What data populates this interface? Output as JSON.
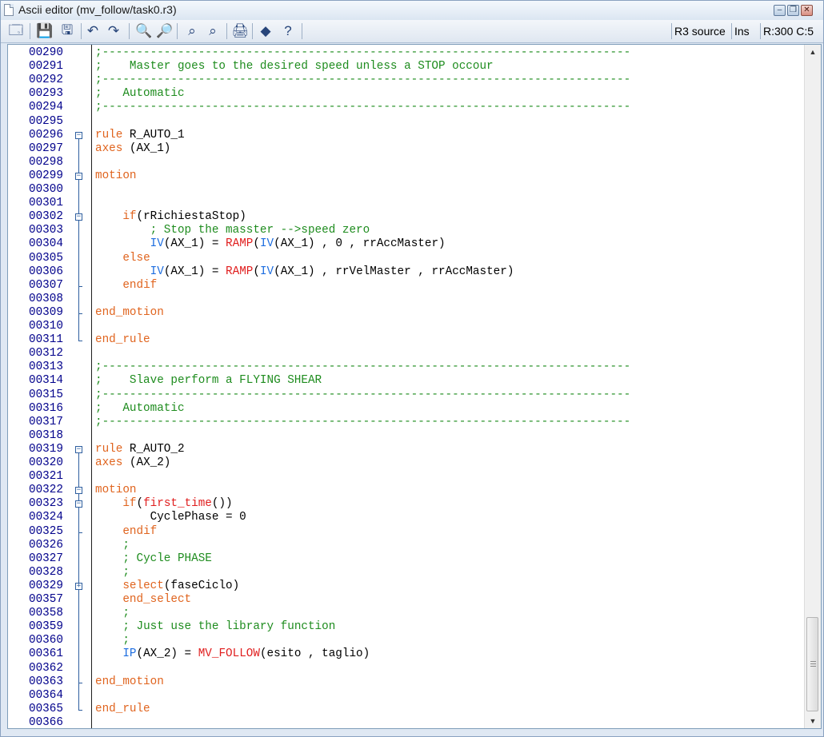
{
  "window": {
    "title": "Ascii editor (mv_follow/task0.r3)",
    "controls": [
      "minimize",
      "restore",
      "close"
    ]
  },
  "toolbar": {
    "buttons": [
      {
        "name": "properties-button",
        "icon": "properties-icon",
        "glyph": "🗔"
      },
      {
        "name": "save-button",
        "icon": "save-icon",
        "glyph": "💾"
      },
      {
        "name": "save-all-button",
        "icon": "save-all-icon",
        "glyph": "🖫"
      },
      {
        "name": "undo-button",
        "icon": "undo-icon",
        "glyph": "↶"
      },
      {
        "name": "redo-button",
        "icon": "redo-icon",
        "glyph": "↷"
      },
      {
        "name": "find-button",
        "icon": "find-icon",
        "glyph": "🔍"
      },
      {
        "name": "find-next-button",
        "icon": "find-next-icon",
        "glyph": "🔎"
      },
      {
        "name": "replace-button",
        "icon": "replace-icon",
        "glyph": "⌕"
      },
      {
        "name": "replace-next-button",
        "icon": "replace-next-icon",
        "glyph": "⌕"
      },
      {
        "name": "print-button",
        "icon": "printer-icon",
        "glyph": "🖨"
      },
      {
        "name": "compile-button",
        "icon": "compile-icon",
        "glyph": "◆"
      },
      {
        "name": "help-button",
        "icon": "help-icon",
        "glyph": "?"
      }
    ],
    "status": {
      "source": "R3 source",
      "mode": "Ins",
      "position": "R:300 C:5"
    }
  },
  "colors": {
    "comment": "#1e8c1e",
    "keyword": "#e0641e",
    "function": "#e01e1e",
    "variable": "#1e6ee0",
    "line_number": "#00008b",
    "text": "#000000"
  },
  "lines": [
    {
      "n": "00290",
      "tokens": [
        [
          "cm",
          ";-----------------------------------------------------------------------------"
        ]
      ]
    },
    {
      "n": "00291",
      "tokens": [
        [
          "cm",
          ";    Master goes to the desired speed unless a STOP occour"
        ]
      ]
    },
    {
      "n": "00292",
      "tokens": [
        [
          "cm",
          ";-----------------------------------------------------------------------------"
        ]
      ]
    },
    {
      "n": "00293",
      "tokens": [
        [
          "cm",
          ";   Automatic"
        ]
      ]
    },
    {
      "n": "00294",
      "tokens": [
        [
          "cm",
          ";-----------------------------------------------------------------------------"
        ]
      ]
    },
    {
      "n": "00295",
      "tokens": []
    },
    {
      "n": "00296",
      "tokens": [
        [
          "kw",
          "rule"
        ],
        [
          "tx",
          " R_AUTO_1"
        ]
      ],
      "fold": "box"
    },
    {
      "n": "00297",
      "tokens": [
        [
          "kw",
          "axes"
        ],
        [
          "tx",
          " (AX_1)"
        ]
      ]
    },
    {
      "n": "00298",
      "tokens": []
    },
    {
      "n": "00299",
      "tokens": [
        [
          "kw",
          "motion"
        ]
      ],
      "fold": "box"
    },
    {
      "n": "00300",
      "tokens": []
    },
    {
      "n": "00301",
      "tokens": []
    },
    {
      "n": "00302",
      "tokens": [
        [
          "tx",
          "    "
        ],
        [
          "kw",
          "if"
        ],
        [
          "tx",
          "(rRichiestaStop)"
        ]
      ],
      "fold": "box"
    },
    {
      "n": "00303",
      "tokens": [
        [
          "tx",
          "        "
        ],
        [
          "cm",
          "; Stop the masster -->speed zero"
        ]
      ]
    },
    {
      "n": "00304",
      "tokens": [
        [
          "tx",
          "        "
        ],
        [
          "iv",
          "IV"
        ],
        [
          "tx",
          "(AX_1) = "
        ],
        [
          "fn",
          "RAMP"
        ],
        [
          "tx",
          "("
        ],
        [
          "iv",
          "IV"
        ],
        [
          "tx",
          "(AX_1) , 0 , rrAccMaster)"
        ]
      ]
    },
    {
      "n": "00305",
      "tokens": [
        [
          "tx",
          "    "
        ],
        [
          "kw",
          "else"
        ]
      ]
    },
    {
      "n": "00306",
      "tokens": [
        [
          "tx",
          "        "
        ],
        [
          "iv",
          "IV"
        ],
        [
          "tx",
          "(AX_1) = "
        ],
        [
          "fn",
          "RAMP"
        ],
        [
          "tx",
          "("
        ],
        [
          "iv",
          "IV"
        ],
        [
          "tx",
          "(AX_1) , rrVelMaster , rrAccMaster)"
        ]
      ]
    },
    {
      "n": "00307",
      "tokens": [
        [
          "tx",
          "    "
        ],
        [
          "kw",
          "endif"
        ]
      ]
    },
    {
      "n": "00308",
      "tokens": []
    },
    {
      "n": "00309",
      "tokens": [
        [
          "kw",
          "end_motion"
        ]
      ]
    },
    {
      "n": "00310",
      "tokens": []
    },
    {
      "n": "00311",
      "tokens": [
        [
          "kw",
          "end_rule"
        ]
      ]
    },
    {
      "n": "00312",
      "tokens": []
    },
    {
      "n": "00313",
      "tokens": [
        [
          "cm",
          ";-----------------------------------------------------------------------------"
        ]
      ]
    },
    {
      "n": "00314",
      "tokens": [
        [
          "cm",
          ";    Slave perform a FLYING SHEAR"
        ]
      ]
    },
    {
      "n": "00315",
      "tokens": [
        [
          "cm",
          ";-----------------------------------------------------------------------------"
        ]
      ]
    },
    {
      "n": "00316",
      "tokens": [
        [
          "cm",
          ";   Automatic"
        ]
      ]
    },
    {
      "n": "00317",
      "tokens": [
        [
          "cm",
          ";-----------------------------------------------------------------------------"
        ]
      ]
    },
    {
      "n": "00318",
      "tokens": []
    },
    {
      "n": "00319",
      "tokens": [
        [
          "kw",
          "rule"
        ],
        [
          "tx",
          " R_AUTO_2"
        ]
      ],
      "fold": "box"
    },
    {
      "n": "00320",
      "tokens": [
        [
          "kw",
          "axes"
        ],
        [
          "tx",
          " (AX_2)"
        ]
      ]
    },
    {
      "n": "00321",
      "tokens": []
    },
    {
      "n": "00322",
      "tokens": [
        [
          "kw",
          "motion"
        ]
      ],
      "fold": "box"
    },
    {
      "n": "00323",
      "tokens": [
        [
          "tx",
          "    "
        ],
        [
          "kw",
          "if"
        ],
        [
          "tx",
          "("
        ],
        [
          "fn",
          "first_time"
        ],
        [
          "tx",
          "())"
        ]
      ],
      "fold": "box"
    },
    {
      "n": "00324",
      "tokens": [
        [
          "tx",
          "        CyclePhase = 0"
        ]
      ]
    },
    {
      "n": "00325",
      "tokens": [
        [
          "tx",
          "    "
        ],
        [
          "kw",
          "endif"
        ]
      ]
    },
    {
      "n": "00326",
      "tokens": [
        [
          "tx",
          "    "
        ],
        [
          "cm",
          ";"
        ]
      ]
    },
    {
      "n": "00327",
      "tokens": [
        [
          "tx",
          "    "
        ],
        [
          "cm",
          "; Cycle PHASE"
        ]
      ]
    },
    {
      "n": "00328",
      "tokens": [
        [
          "tx",
          "    "
        ],
        [
          "cm",
          ";"
        ]
      ]
    },
    {
      "n": "00329",
      "tokens": [
        [
          "tx",
          "    "
        ],
        [
          "kw",
          "select"
        ],
        [
          "tx",
          "(faseCiclo)"
        ]
      ],
      "fold": "plus"
    },
    {
      "n": "00357",
      "tokens": [
        [
          "tx",
          "    "
        ],
        [
          "kw",
          "end_select"
        ]
      ]
    },
    {
      "n": "00358",
      "tokens": [
        [
          "tx",
          "    "
        ],
        [
          "cm",
          ";"
        ]
      ]
    },
    {
      "n": "00359",
      "tokens": [
        [
          "tx",
          "    "
        ],
        [
          "cm",
          "; Just use the library function"
        ]
      ]
    },
    {
      "n": "00360",
      "tokens": [
        [
          "tx",
          "    "
        ],
        [
          "cm",
          ";"
        ]
      ]
    },
    {
      "n": "00361",
      "tokens": [
        [
          "tx",
          "    "
        ],
        [
          "iv",
          "IP"
        ],
        [
          "tx",
          "(AX_2) = "
        ],
        [
          "fn",
          "MV_FOLLOW"
        ],
        [
          "tx",
          "(esito , taglio)"
        ]
      ]
    },
    {
      "n": "00362",
      "tokens": []
    },
    {
      "n": "00363",
      "tokens": [
        [
          "kw",
          "end_motion"
        ]
      ]
    },
    {
      "n": "00364",
      "tokens": []
    },
    {
      "n": "00365",
      "tokens": [
        [
          "kw",
          "end_rule"
        ]
      ]
    },
    {
      "n": "00366",
      "tokens": []
    }
  ]
}
